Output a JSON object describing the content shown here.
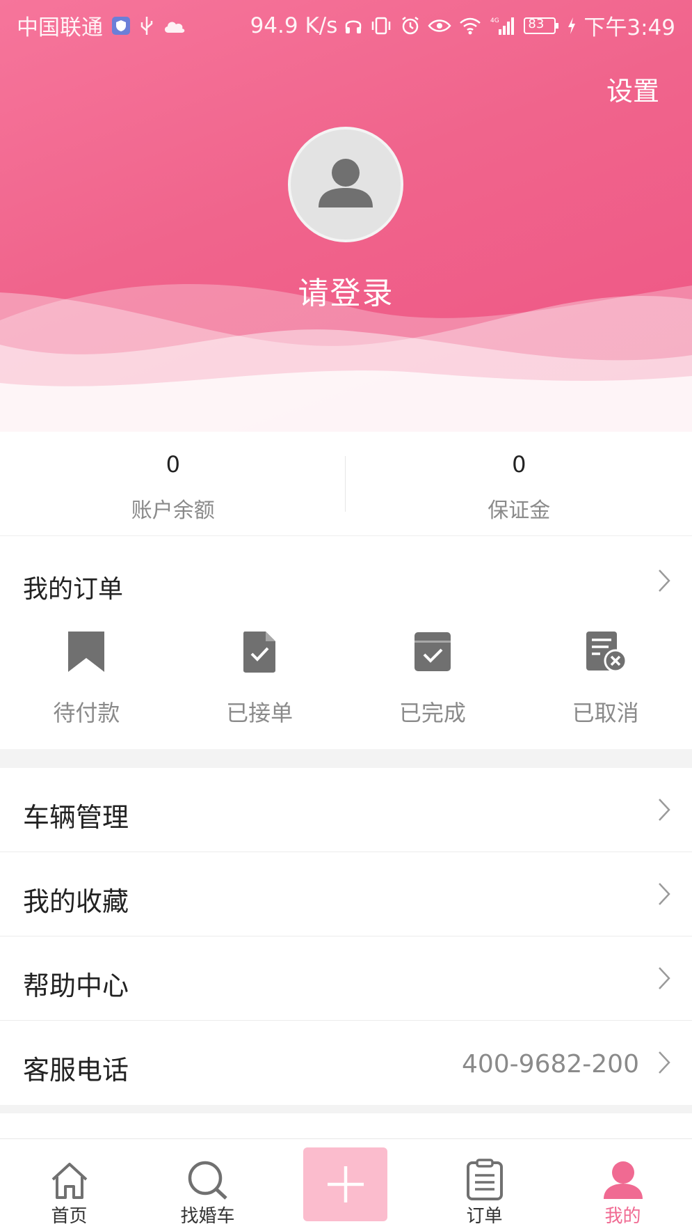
{
  "status_bar": {
    "carrier": "中国联通",
    "net_speed": "94.9 K/s",
    "battery": "83",
    "time": "下午3:49"
  },
  "header": {
    "settings_label": "设置",
    "login_text": "请登录"
  },
  "stats": [
    {
      "value": "0",
      "label": "账户余额"
    },
    {
      "value": "0",
      "label": "保证金"
    }
  ],
  "orders": {
    "title": "我的订单",
    "items": [
      {
        "label": "待付款",
        "icon": "bookmark-icon"
      },
      {
        "label": "已接单",
        "icon": "document-check-icon"
      },
      {
        "label": "已完成",
        "icon": "box-check-icon"
      },
      {
        "label": "已取消",
        "icon": "document-cancel-icon"
      }
    ]
  },
  "menu": [
    {
      "label": "车辆管理",
      "value": ""
    },
    {
      "label": "我的收藏",
      "value": ""
    },
    {
      "label": "帮助中心",
      "value": ""
    },
    {
      "label": "客服电话",
      "value": "400-9682-200"
    }
  ],
  "tabbar": {
    "items": [
      {
        "label": "首页",
        "icon": "home-icon"
      },
      {
        "label": "找婚车",
        "icon": "search-icon"
      },
      {
        "label": "订单",
        "icon": "clipboard-icon"
      },
      {
        "label": "我的",
        "icon": "user-icon"
      }
    ],
    "add_icon": "plus-icon",
    "active_index": 3
  },
  "colors": {
    "brand_pink": "#f06a92",
    "header_gradient_start": "#f6759b",
    "header_gradient_end": "#ee5584",
    "add_button": "#fbbccd",
    "icon_gray": "#707070",
    "muted_text": "#8a8a8a"
  }
}
